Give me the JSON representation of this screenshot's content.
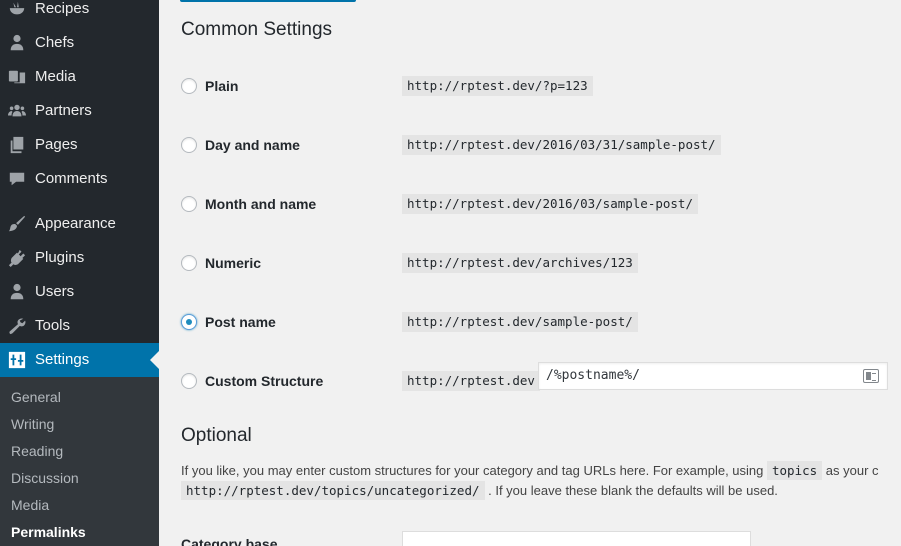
{
  "sidebar": {
    "items": [
      {
        "name": "recipes",
        "label": "Recipes",
        "icon": "recipes-icon"
      },
      {
        "name": "chefs",
        "label": "Chefs",
        "icon": "user-icon"
      },
      {
        "name": "media",
        "label": "Media",
        "icon": "media-icon"
      },
      {
        "name": "partners",
        "label": "Partners",
        "icon": "groups-icon"
      },
      {
        "name": "pages",
        "label": "Pages",
        "icon": "pages-icon"
      },
      {
        "name": "comments",
        "label": "Comments",
        "icon": "comment-icon"
      },
      {
        "name": "appearance",
        "label": "Appearance",
        "icon": "paintbrush-icon"
      },
      {
        "name": "plugins",
        "label": "Plugins",
        "icon": "plugin-icon"
      },
      {
        "name": "users",
        "label": "Users",
        "icon": "users-icon"
      },
      {
        "name": "tools",
        "label": "Tools",
        "icon": "wrench-icon"
      },
      {
        "name": "settings",
        "label": "Settings",
        "icon": "settings-icon",
        "active": true
      }
    ],
    "submenu": [
      "General",
      "Writing",
      "Reading",
      "Discussion",
      "Media",
      "Permalinks"
    ],
    "submenu_current": "Permalinks"
  },
  "main": {
    "common_title": "Common Settings",
    "options": [
      {
        "label": "Plain",
        "example": "http://rptest.dev/?p=123",
        "checked": false
      },
      {
        "label": "Day and name",
        "example": "http://rptest.dev/2016/03/31/sample-post/",
        "checked": false
      },
      {
        "label": "Month and name",
        "example": "http://rptest.dev/2016/03/sample-post/",
        "checked": false
      },
      {
        "label": "Numeric",
        "example": "http://rptest.dev/archives/123",
        "checked": false
      },
      {
        "label": "Post name",
        "example": "http://rptest.dev/sample-post/",
        "checked": true
      },
      {
        "label": "Custom Structure",
        "example": "http://rptest.dev",
        "checked": false
      }
    ],
    "custom_structure_value": "/%postname%/",
    "optional_title": "Optional",
    "optional_text_1_a": "If you like, you may enter custom structures for your category and tag URLs here. For example, using",
    "optional_text_1_code": "topics",
    "optional_text_1_b": "as your c",
    "optional_text_2_code": "http://rptest.dev/topics/uncategorized/",
    "optional_text_2_b": ". If you leave these blank the defaults will be used.",
    "category_base_label": "Category base"
  },
  "colors": {
    "sidebar_bg": "#23282d",
    "submenu_bg": "#32373c",
    "accent": "#0073aa",
    "page_bg": "#f1f1f1"
  }
}
